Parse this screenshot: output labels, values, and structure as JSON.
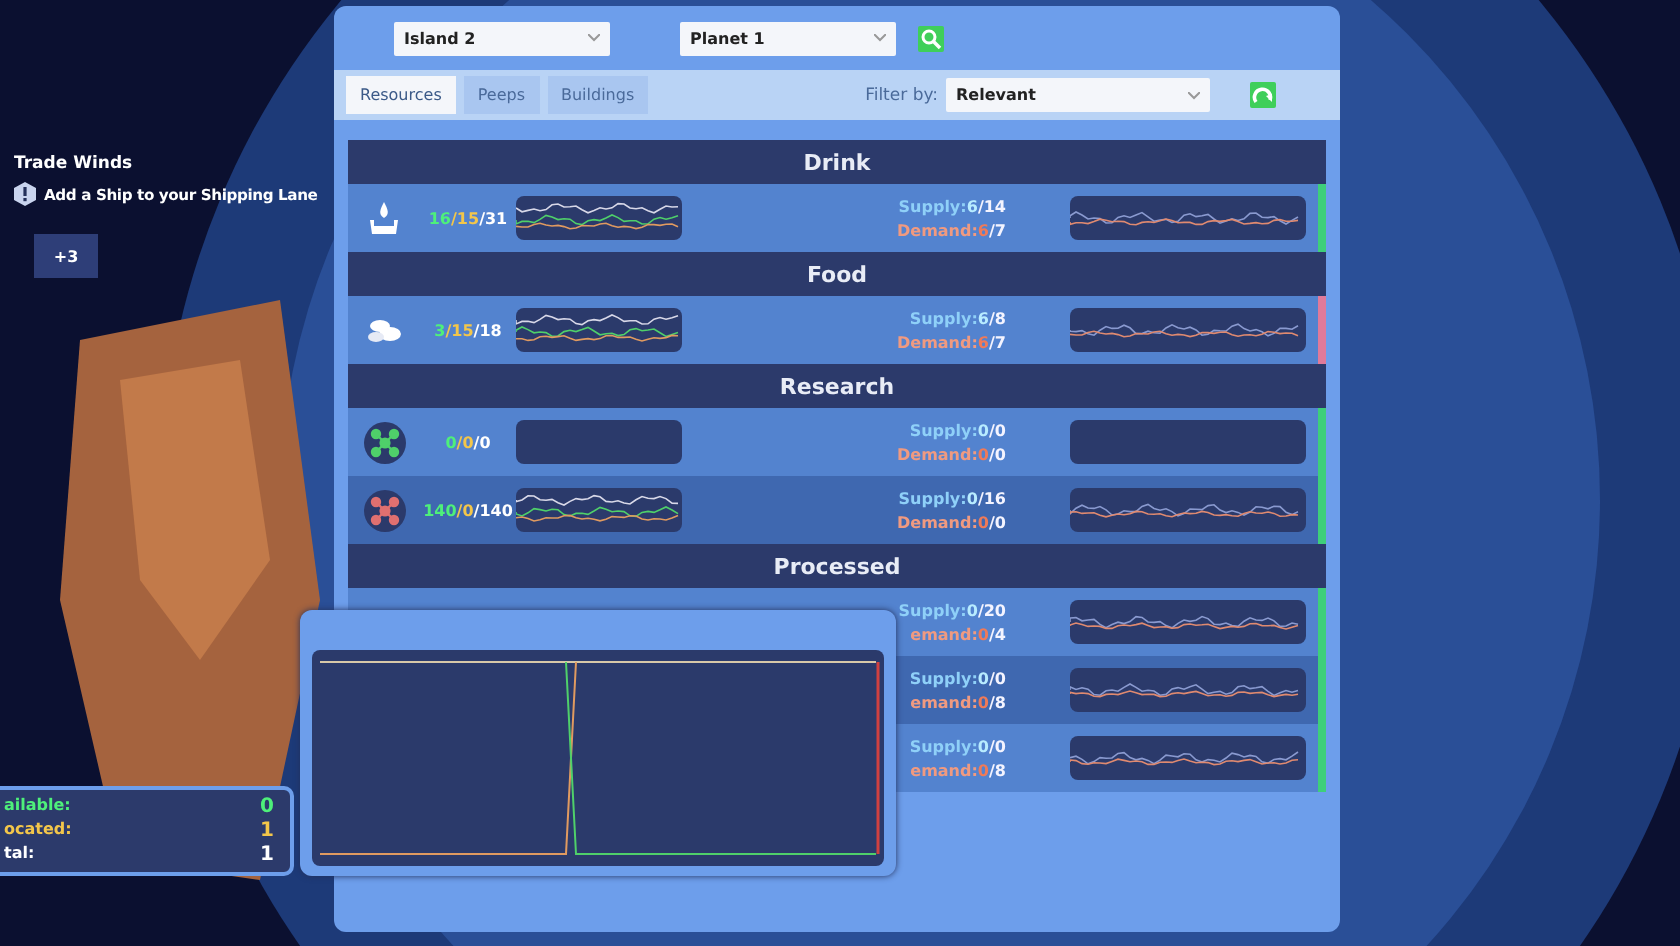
{
  "quest": {
    "title": "Trade Winds",
    "task": "Add a Ship to your Shipping Lane",
    "more": "+3"
  },
  "selectors": {
    "island": "Island 2",
    "planet": "Planet 1"
  },
  "tabs": [
    {
      "label": "Resources",
      "selected": true
    },
    {
      "label": "Peeps",
      "selected": false
    },
    {
      "label": "Buildings",
      "selected": false
    }
  ],
  "filter": {
    "label": "Filter by:",
    "value": "Relevant"
  },
  "groups": [
    {
      "title": "Drink",
      "rows": [
        {
          "kind": "drink",
          "counts": [
            "16",
            "/15",
            "/31"
          ],
          "supply": [
            "Supply:",
            "6",
            "/14"
          ],
          "demand": [
            "Demand:",
            "6",
            "/7"
          ],
          "color": "#3ecf7a"
        }
      ]
    },
    {
      "title": "Food",
      "rows": [
        {
          "kind": "food",
          "counts": [
            "3",
            "/15",
            "/18"
          ],
          "supply": [
            "Supply:",
            "6",
            "/8"
          ],
          "demand": [
            "Demand:",
            "6",
            "/7"
          ],
          "color": "#e07a9a"
        }
      ]
    },
    {
      "title": "Research",
      "rows": [
        {
          "kind": "research_idle",
          "counts": [
            "0",
            "/0",
            "/0"
          ],
          "supply": [
            "Supply:",
            "0",
            "/0"
          ],
          "demand": [
            "Demand:",
            "0",
            "/0"
          ],
          "color": "#3ecf7a"
        },
        {
          "kind": "research_active",
          "counts": [
            "140",
            "/0",
            "/140"
          ],
          "supply": [
            "Supply:",
            "0",
            "/16"
          ],
          "demand": [
            "Demand:",
            "0",
            "/0"
          ],
          "color": "#3ecf7a"
        }
      ]
    },
    {
      "title": "Processed",
      "rows": [
        {
          "kind": "processed",
          "supply": [
            "Supply:",
            "0",
            "/20"
          ],
          "demand": [
            "emand:",
            "0",
            "/4"
          ],
          "color": "#3ecf7a"
        },
        {
          "kind": "processed",
          "supply": [
            "Supply:",
            "0",
            "/0"
          ],
          "demand": [
            "emand:",
            "0",
            "/8"
          ],
          "color": "#3ecf7a"
        },
        {
          "kind": "processed",
          "supply": [
            "Supply:",
            "0",
            "/0"
          ],
          "demand": [
            "emand:",
            "0",
            "/8"
          ],
          "color": "#3ecf7a"
        }
      ]
    }
  ],
  "workers": [
    {
      "label": "ailable:",
      "value": "0",
      "kind": "available"
    },
    {
      "label": "ocated:",
      "value": "1",
      "kind": "allocated"
    },
    {
      "label": "tal:",
      "value": "1",
      "kind": "total"
    }
  ]
}
